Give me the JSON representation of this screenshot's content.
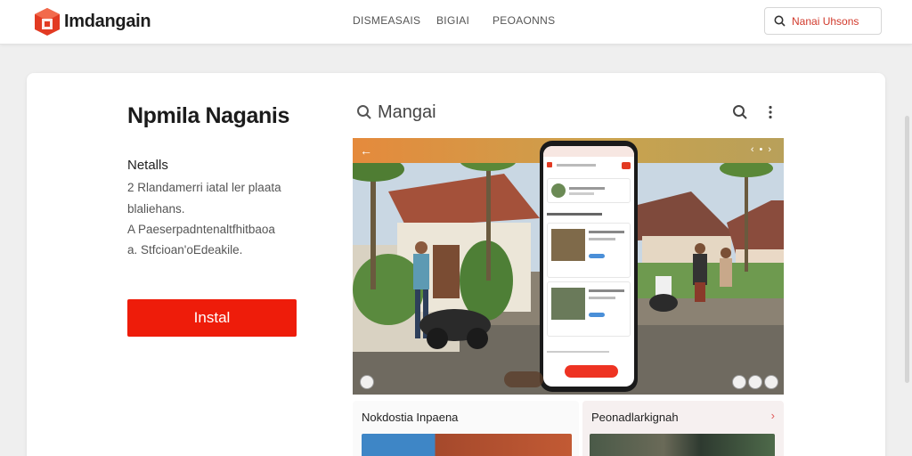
{
  "header": {
    "brand": "Imdangain",
    "nav": [
      "DISMEASAIS",
      "BIGIAI",
      "PEOAONNS"
    ],
    "search_text": "Nanai Uhsons"
  },
  "app": {
    "title": "Npmila Naganis",
    "details_heading": "Netalls",
    "details": [
      "2 Rlandamerri iatal ler plaata",
      "blaliehans.",
      "A Paeserpadntenaltfhitbaoa",
      "a. Stfcioan'oEdeakile."
    ],
    "install_label": "Instal"
  },
  "preview": {
    "search_text": "Mangai"
  },
  "tiles": [
    {
      "title": "Nokdostia Inpaena"
    },
    {
      "title": "Peonadlarkignah"
    }
  ],
  "colors": {
    "accent": "#ee1c0a",
    "topbar": "#e58a3c"
  }
}
